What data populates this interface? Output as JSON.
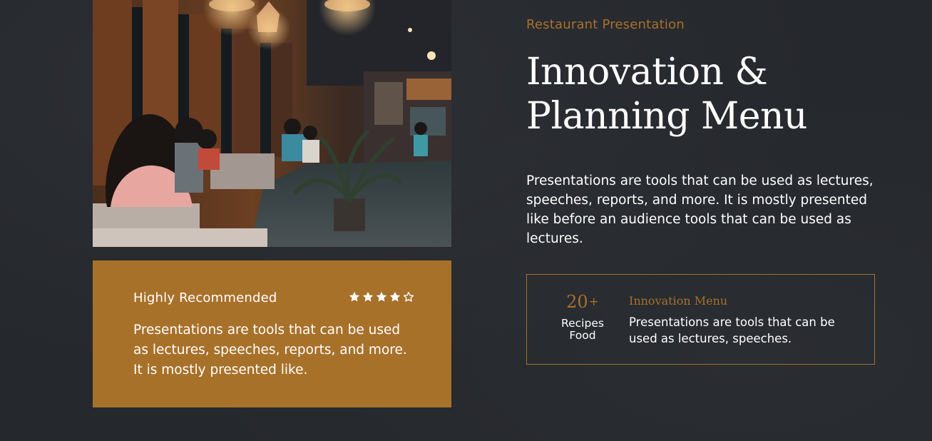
{
  "colors": {
    "background": "#25282d",
    "accent": "#a8712a",
    "text": "#ffffff"
  },
  "hero_image": {
    "icon": "restaurant-interior-photo"
  },
  "recommendation": {
    "title": "Highly Recommended",
    "rating": 4,
    "rating_max": 5,
    "text": "Presentations are tools that can be used as lectures, speeches, reports, and more. It is mostly presented like."
  },
  "header": {
    "eyebrow": "Restaurant Presentation",
    "title_line1": "Innovation &",
    "title_line2": "Planning Menu"
  },
  "description": "Presentations are tools that can be used as lectures, speeches, reports, and more. It is mostly presented like before an audience tools that can be used as lectures.",
  "stats": {
    "count": "20",
    "count_suffix": "+",
    "label_line1": "Recipes",
    "label_line2": "Food",
    "title": "Innovation Menu",
    "text": "Presentations are tools that can be used as lectures, speeches."
  }
}
